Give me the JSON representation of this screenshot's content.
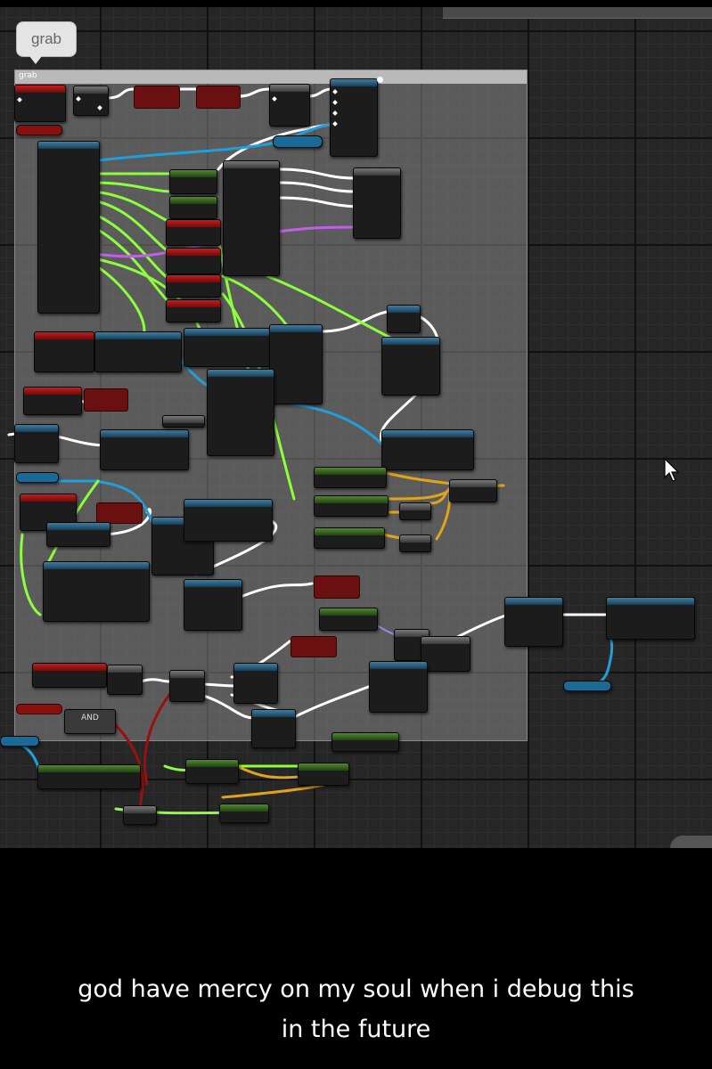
{
  "comment_bubble": {
    "label": "grab"
  },
  "comment_box": {
    "title": "grab"
  },
  "logic_node": {
    "label": "AND"
  },
  "caption": {
    "line1": "god have mercy on my soul when i debug this",
    "line2": "in the future"
  },
  "colors": {
    "exec_wire": "#ffffff",
    "float_wire": "#8cff3c",
    "object_wire": "#1f9fdc",
    "struct_wire": "#e0a418",
    "bool_wire": "#9a1010",
    "vector_wire": "#c060e8",
    "event_header": "#c81c1c",
    "function_header": "#3a7fa6",
    "pure_header": "#4e8a2a"
  },
  "icons": [
    "mouse-cursor-icon"
  ]
}
